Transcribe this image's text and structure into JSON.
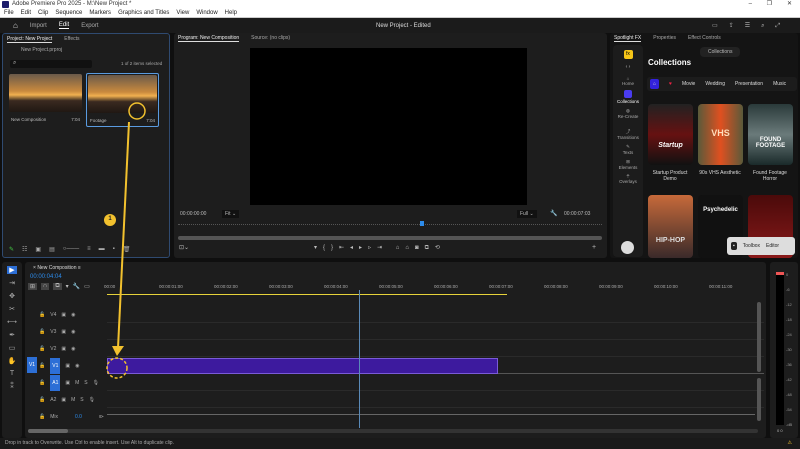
{
  "window": {
    "title": "Adobe Premiere Pro 2025 - M:\\New Project *",
    "min": "–",
    "max": "❐",
    "close": "✕"
  },
  "menu": [
    "File",
    "Edit",
    "Clip",
    "Sequence",
    "Markers",
    "Graphics and Titles",
    "View",
    "Window",
    "Help"
  ],
  "appbar": {
    "tabs": [
      "Import",
      "Edit",
      "Export"
    ],
    "active": "Edit",
    "center": "New Project - Edited"
  },
  "project": {
    "tabs": [
      "Project: New Project",
      "Effects"
    ],
    "file": "New Project.prproj",
    "selection": "1 of 2 items selected",
    "items": [
      {
        "name": "New Composition",
        "duration": "7:04"
      },
      {
        "name": "Footage",
        "duration": "7:04"
      }
    ]
  },
  "program": {
    "tabs": [
      "Program: New Composition",
      "Source: (no clips)"
    ],
    "timecode": "00:00:00:00",
    "fit": "Fit",
    "quality": "Full",
    "duration": "00:00:07:03"
  },
  "spotlight": {
    "tabs": [
      "Spotlight FX",
      "Properties",
      "Effect Controls"
    ],
    "pill": "Collections",
    "title": "Collections",
    "filters": [
      "Movie",
      "Wedding",
      "Presentation",
      "Music"
    ],
    "nav": [
      "Home",
      "Collections",
      "Re-Create",
      "Transitions",
      "Texts",
      "Elements",
      "Overlays"
    ],
    "cards": [
      {
        "name": "Startup Product Demo",
        "art": "Startup"
      },
      {
        "name": "90s VHS Aesthetic",
        "art": "VHS"
      },
      {
        "name": "Found Footage Horror",
        "art": "FOUND FOOTAGE"
      },
      {
        "name": "",
        "art": "HIP-HOP"
      },
      {
        "name": "",
        "art": "Psychedelic"
      },
      {
        "name": "",
        "art": ""
      }
    ],
    "toolbox": "Toolbox",
    "editor": "Editor"
  },
  "timeline": {
    "name": "New Composition",
    "timecode": "00:00:04:04",
    "ruler": [
      "00:00",
      "00:00:01:00",
      "00:00:02:00",
      "00:00:03:00",
      "00:00:04:00",
      "00:00:05:00",
      "00:00:06:00",
      "00:00:07:00",
      "00:00:08:00",
      "00:00:09:00",
      "00:00:10:00",
      "00:00:11:00"
    ],
    "video_tracks": [
      "V4",
      "V3",
      "V2",
      "V1"
    ],
    "audio_tracks": [
      "A1",
      "A2"
    ],
    "mix": "Mix",
    "mix_value": "0.0",
    "source_patch": "V1",
    "playhead_seconds": 4.16,
    "clip_end_seconds": 7.04
  },
  "meter": {
    "labels": [
      "0",
      "-6",
      "-12",
      "-18",
      "-24",
      "-30",
      "-36",
      "-42",
      "-48",
      "-54",
      "-dB"
    ],
    "bottom": "0 0"
  },
  "annotation": {
    "step": "1"
  },
  "status": "Drop in track to Overwrite. Use Ctrl to enable insert. Use Alt to duplicate clip.",
  "colors": {
    "accent": "#2d8ceb",
    "clip": "#3d1a9e",
    "annotation": "#f2c12e"
  }
}
